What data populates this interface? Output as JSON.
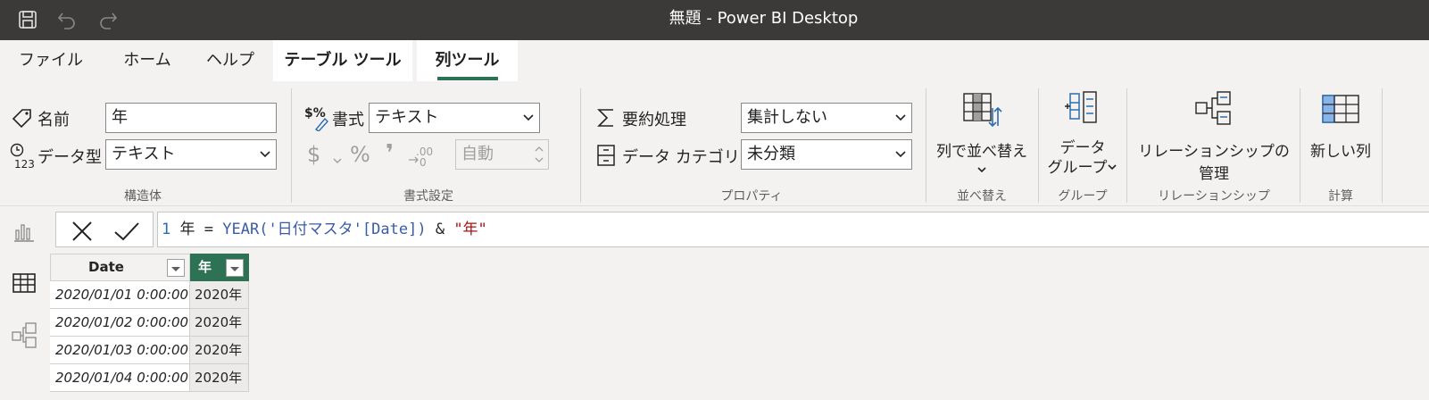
{
  "window": {
    "title": "無題 - Power BI Desktop"
  },
  "quick_access": {
    "save": "save-icon",
    "undo": "undo-icon",
    "redo": "redo-icon"
  },
  "tabs": {
    "file": "ファイル",
    "home": "ホーム",
    "help": "ヘルプ",
    "table_tools": "テーブル ツール",
    "column_tools": "列ツール"
  },
  "ribbon": {
    "structure": {
      "name_label": "名前",
      "name_value": "年",
      "datatype_label": "データ型",
      "datatype_value": "テキスト",
      "group_label": "構造体"
    },
    "formatting": {
      "format_label": "書式",
      "format_value": "テキスト",
      "currency_symbol": "$",
      "percent_symbol": "%",
      "comma_symbol": "❜",
      "decimal_glyph": ".00",
      "decimal_places_value": "自動",
      "group_label": "書式設定"
    },
    "properties": {
      "summarize_label": "要約処理",
      "summarize_value": "集計しない",
      "category_label": "データ カテゴリ",
      "category_value": "未分類",
      "group_label": "プロパティ"
    },
    "sort": {
      "button_label": "列で並べ替え",
      "group_label": "並べ替え"
    },
    "groups": {
      "button_label_line1": "データ",
      "button_label_line2": "グループ",
      "group_label": "グループ"
    },
    "relationships": {
      "button_label": "リレーションシップの管理",
      "group_label": "リレーションシップ"
    },
    "calculations": {
      "button_label": "新しい列",
      "group_label": "計算"
    }
  },
  "formula": {
    "line_number": "1",
    "column_name": "年",
    "equals": "=",
    "function": "YEAR",
    "argument": "('日付マスタ'[Date])",
    "ampersand": "&",
    "string_literal": "\"年\""
  },
  "table": {
    "columns": [
      "Date",
      "年"
    ],
    "rows": [
      [
        "2020/01/01 0:00:00",
        "2020年"
      ],
      [
        "2020/01/02 0:00:00",
        "2020年"
      ],
      [
        "2020/01/03 0:00:00",
        "2020年"
      ],
      [
        "2020/01/04 0:00:00",
        "2020年"
      ]
    ]
  },
  "colors": {
    "titlebar": "#3b3a39",
    "accent": "#2e7256",
    "selected_header": "#2e7256"
  }
}
